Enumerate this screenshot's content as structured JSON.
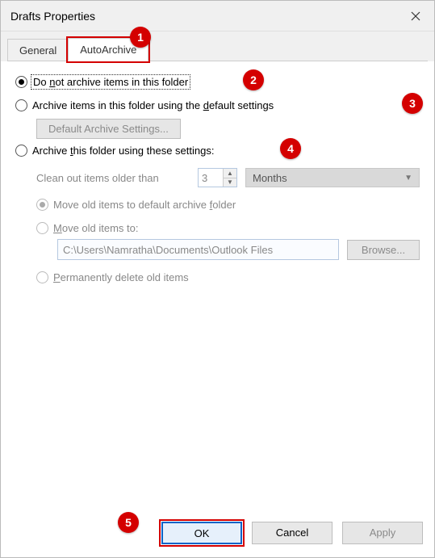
{
  "window": {
    "title": "Drafts Properties"
  },
  "tabs": {
    "general": "General",
    "autoarchive": "AutoArchive"
  },
  "options": {
    "no_archive_pre": "Do ",
    "no_archive_ul": "n",
    "no_archive_post": "ot archive items in this folder",
    "default_pre": "Archive items in this folder using the ",
    "default_ul": "d",
    "default_post": "efault settings",
    "custom_pre": "Archive ",
    "custom_ul": "t",
    "custom_post": "his folder using these settings:"
  },
  "default_button_pre": "Default Archive ",
  "default_button_ul": "S",
  "default_button_post": "ettings...",
  "clean": {
    "label_ul": "C",
    "label_post": "lean out items older than",
    "value": "3",
    "unit": "Months"
  },
  "move_default_pre": "Move old items to default archive ",
  "move_default_ul": "f",
  "move_default_post": "older",
  "move_to_ul": "M",
  "move_to_post": "ove old items to:",
  "path": "C:\\Users\\Namratha\\Documents\\Outlook Files",
  "browse_ul": "B",
  "browse_post": "rowse...",
  "perm_ul": "P",
  "perm_post": "ermanently delete old items",
  "buttons": {
    "ok": "OK",
    "cancel": "Cancel",
    "apply": "Apply"
  },
  "markers": {
    "m1": "1",
    "m2": "2",
    "m3": "3",
    "m4": "4",
    "m5": "5"
  }
}
